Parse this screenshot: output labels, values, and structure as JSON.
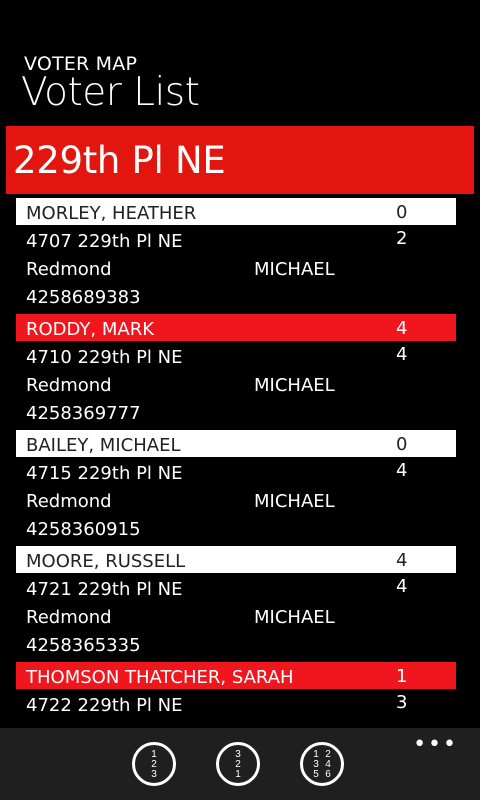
{
  "header": {
    "app_title": "VOTER MAP",
    "page_title": "Voter List"
  },
  "street": {
    "name": "229th Pl NE"
  },
  "voters": [
    {
      "name": "MORLEY, HEATHER",
      "score": "0",
      "address": "4707 229th Pl NE",
      "score2": "2",
      "city": "Redmond",
      "rep": "MICHAEL",
      "phone": "4258689383",
      "highlight": false
    },
    {
      "name": "RODDY, MARK",
      "score": "4",
      "address": "4710 229th Pl NE",
      "score2": "4",
      "city": "Redmond",
      "rep": "MICHAEL",
      "phone": "4258369777",
      "highlight": true
    },
    {
      "name": "BAILEY, MICHAEL",
      "score": "0",
      "address": "4715 229th Pl NE",
      "score2": "4",
      "city": "Redmond",
      "rep": "MICHAEL",
      "phone": "4258360915",
      "highlight": false
    },
    {
      "name": "MOORE, RUSSELL",
      "score": "4",
      "address": "4721 229th Pl NE",
      "score2": "4",
      "city": "Redmond",
      "rep": "MICHAEL",
      "phone": "4258365335",
      "highlight": false
    },
    {
      "name": "THOMSON THATCHER, SARAH",
      "score": "1",
      "address": "4722 229th Pl NE",
      "score2": "3",
      "city": "",
      "rep": "",
      "phone": "",
      "highlight": true
    }
  ],
  "appbar": {
    "buttons": [
      {
        "icon": "sort-ascending-icon",
        "glyph_lines": [
          "1",
          "2",
          "3"
        ]
      },
      {
        "icon": "sort-descending-icon",
        "glyph_lines": [
          "3",
          "2",
          "1"
        ]
      },
      {
        "icon": "sort-odd-even-icon",
        "glyph_lines": [
          "1",
          "2",
          "3",
          "4",
          "5",
          "6"
        ]
      }
    ],
    "more_label": "•••"
  },
  "colors": {
    "accent_red": "#e3150f",
    "row_red": "#f0161d",
    "row_white": "#ffffff",
    "appbar_bg": "#1f1f1f"
  }
}
